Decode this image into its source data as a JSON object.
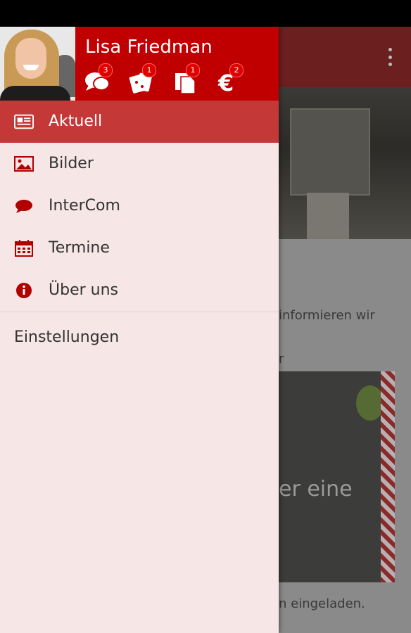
{
  "drawer": {
    "user_name": "Lisa Friedman",
    "badges": [
      {
        "icon": "chat-bubbles-icon",
        "count": "3"
      },
      {
        "icon": "coupons-icon",
        "count": "1"
      },
      {
        "icon": "documents-icon",
        "count": "1"
      },
      {
        "icon": "euro-icon",
        "count": "2"
      }
    ],
    "menu": [
      {
        "label": "Aktuell",
        "icon": "newspaper-icon",
        "active": true
      },
      {
        "label": "Bilder",
        "icon": "image-icon"
      },
      {
        "label": "InterCom",
        "icon": "chat-bubble-icon"
      },
      {
        "label": "Termine",
        "icon": "calendar-icon"
      },
      {
        "label": "Über uns",
        "icon": "info-icon"
      }
    ],
    "settings_label": "Einstellungen"
  },
  "background": {
    "text_line1": "informieren wir",
    "text_line2": "r",
    "card_overlay_text": "er eine",
    "footer_text": "n eingeladen."
  },
  "colors": {
    "brand_red": "#c00000",
    "active_item": "#c53838",
    "drawer_bg": "#f6e6e6"
  }
}
